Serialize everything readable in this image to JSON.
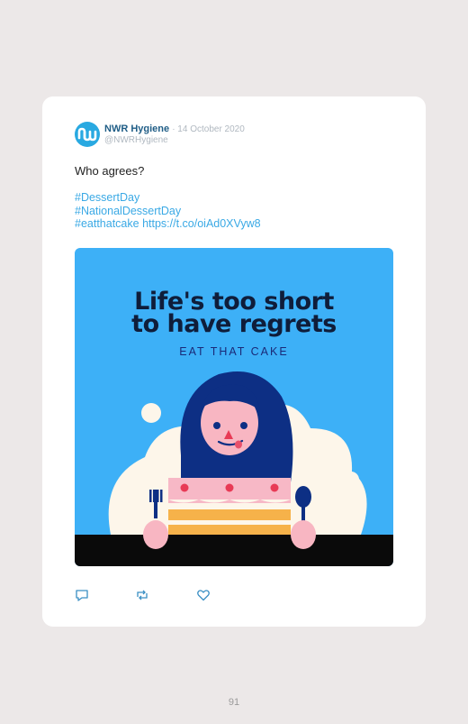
{
  "tweet": {
    "author_name": "NWR Hygiene",
    "date": "· 14 October 2020",
    "handle": "@NWRHygiene",
    "text": "Who agrees?",
    "hashtags": [
      "#DessertDay",
      "#NationalDessertDay"
    ],
    "last_tag": "#eatthatcake",
    "link": "https://t.co/oiAd0XVyw8"
  },
  "media": {
    "headline_line1": "Life's too short",
    "headline_line2": "to have regrets",
    "subline": "EAT THAT CAKE"
  },
  "icons": {
    "avatar": "nw-logo-icon",
    "reply": "reply-icon",
    "retweet": "retweet-icon",
    "like": "heart-icon"
  },
  "colors": {
    "accent": "#3aa9e5",
    "name": "#1f5d86",
    "media_bg": "#3db0f7",
    "page_bg": "#ece8e8"
  },
  "page_number": "91"
}
